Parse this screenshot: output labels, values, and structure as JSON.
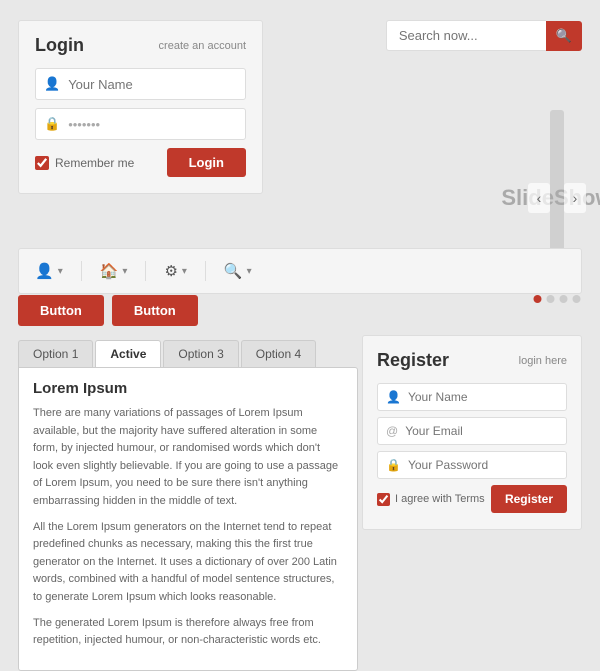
{
  "login": {
    "title": "Login",
    "create_account_label": "create an account",
    "name_placeholder": "Your Name",
    "password_placeholder": "•••••••",
    "remember_label": "Remember me",
    "login_button": "Login"
  },
  "search": {
    "placeholder": "Search now...",
    "button_icon": "🔍"
  },
  "slideshow": {
    "label": "SlideShow",
    "arrow_left": "‹",
    "arrow_right": "›",
    "dots": [
      true,
      false,
      false,
      false
    ]
  },
  "navbar": {
    "items": [
      {
        "icon": "👤",
        "has_chevron": true
      },
      {
        "icon": "🏠",
        "has_chevron": true
      },
      {
        "icon": "⚙",
        "has_chevron": true
      },
      {
        "icon": "🔍",
        "has_chevron": true
      }
    ]
  },
  "buttons": [
    {
      "label": "Button"
    },
    {
      "label": "Button"
    }
  ],
  "tabs": {
    "items": [
      {
        "label": "Option 1",
        "active": false
      },
      {
        "label": "Active",
        "active": true
      },
      {
        "label": "Option 3",
        "active": false
      },
      {
        "label": "Option 4",
        "active": false
      }
    ],
    "content_title": "Lorem Ipsum",
    "content_paragraphs": [
      "There are many variations of passages of Lorem Ipsum available, but the majority have suffered alteration in some form, by injected humour, or randomised words which don't look even slightly believable. If you are going to use a passage of Lorem Ipsum, you need to be sure there isn't anything embarrassing hidden in the middle of text.",
      "All the Lorem Ipsum generators on the Internet tend to repeat predefined chunks as necessary, making this the first true generator on the Internet. It uses a dictionary of over 200 Latin words, combined with a handful of model sentence structures, to generate Lorem Ipsum which looks reasonable.",
      "The generated Lorem Ipsum is therefore always free from repetition, injected humour, or non-characteristic words etc."
    ]
  },
  "register": {
    "title": "Register",
    "login_here_label": "login here",
    "name_placeholder": "Your Name",
    "email_placeholder": "Your Email",
    "password_placeholder": "Your Password",
    "agree_label": "I agree with Terms",
    "register_button": "Register"
  }
}
